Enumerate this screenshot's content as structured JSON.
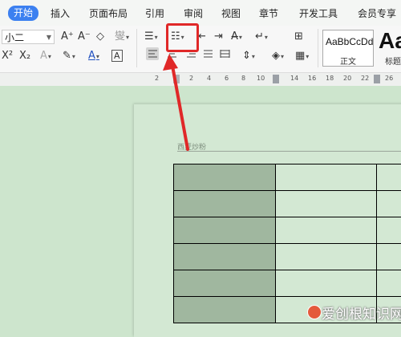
{
  "menubar": {
    "tabs": [
      {
        "label": "开始",
        "active": true
      },
      {
        "label": "插入"
      },
      {
        "label": "页面布局"
      },
      {
        "label": "引用"
      },
      {
        "label": "审阅"
      },
      {
        "label": "视图"
      },
      {
        "label": "章节"
      },
      {
        "label": "开发工具"
      },
      {
        "label": "会员专享"
      }
    ]
  },
  "ribbon": {
    "font_size": "小二",
    "grow_font": "A⁺",
    "shrink_font": "A⁻",
    "clear_format": "◇",
    "pinyin": "燮",
    "superscript": "X²",
    "subscript": "X₂",
    "text_effect": "A",
    "highlight": "✎",
    "font_color": "A",
    "char_border": "A",
    "bullets": "☰",
    "numbering": "☷",
    "decrease_indent": "⇤",
    "increase_indent": "⇥",
    "sort": "A̶",
    "show_marks": "↵",
    "table_tool": "⊞",
    "line_spacing": "⇕",
    "shading": "◈",
    "borders": "▦",
    "styles": [
      {
        "sample": "AaBbCcDd",
        "name": "正文"
      },
      {
        "sample": "Aa",
        "name": "标题"
      }
    ]
  },
  "ruler": {
    "numbers": [
      "2",
      "2",
      "4",
      "6",
      "8",
      "10",
      "12",
      "14",
      "16",
      "18",
      "20",
      "22",
      "24",
      "26"
    ]
  },
  "document": {
    "header": "西夏炒粉",
    "table_rows": 6
  },
  "watermark": {
    "text": "爱创根知识网"
  },
  "colors": {
    "accent": "#3c80f0",
    "annotation": "#e02828",
    "doc_background": "#cde5cd",
    "shaded_cell": "#a0b79f"
  }
}
